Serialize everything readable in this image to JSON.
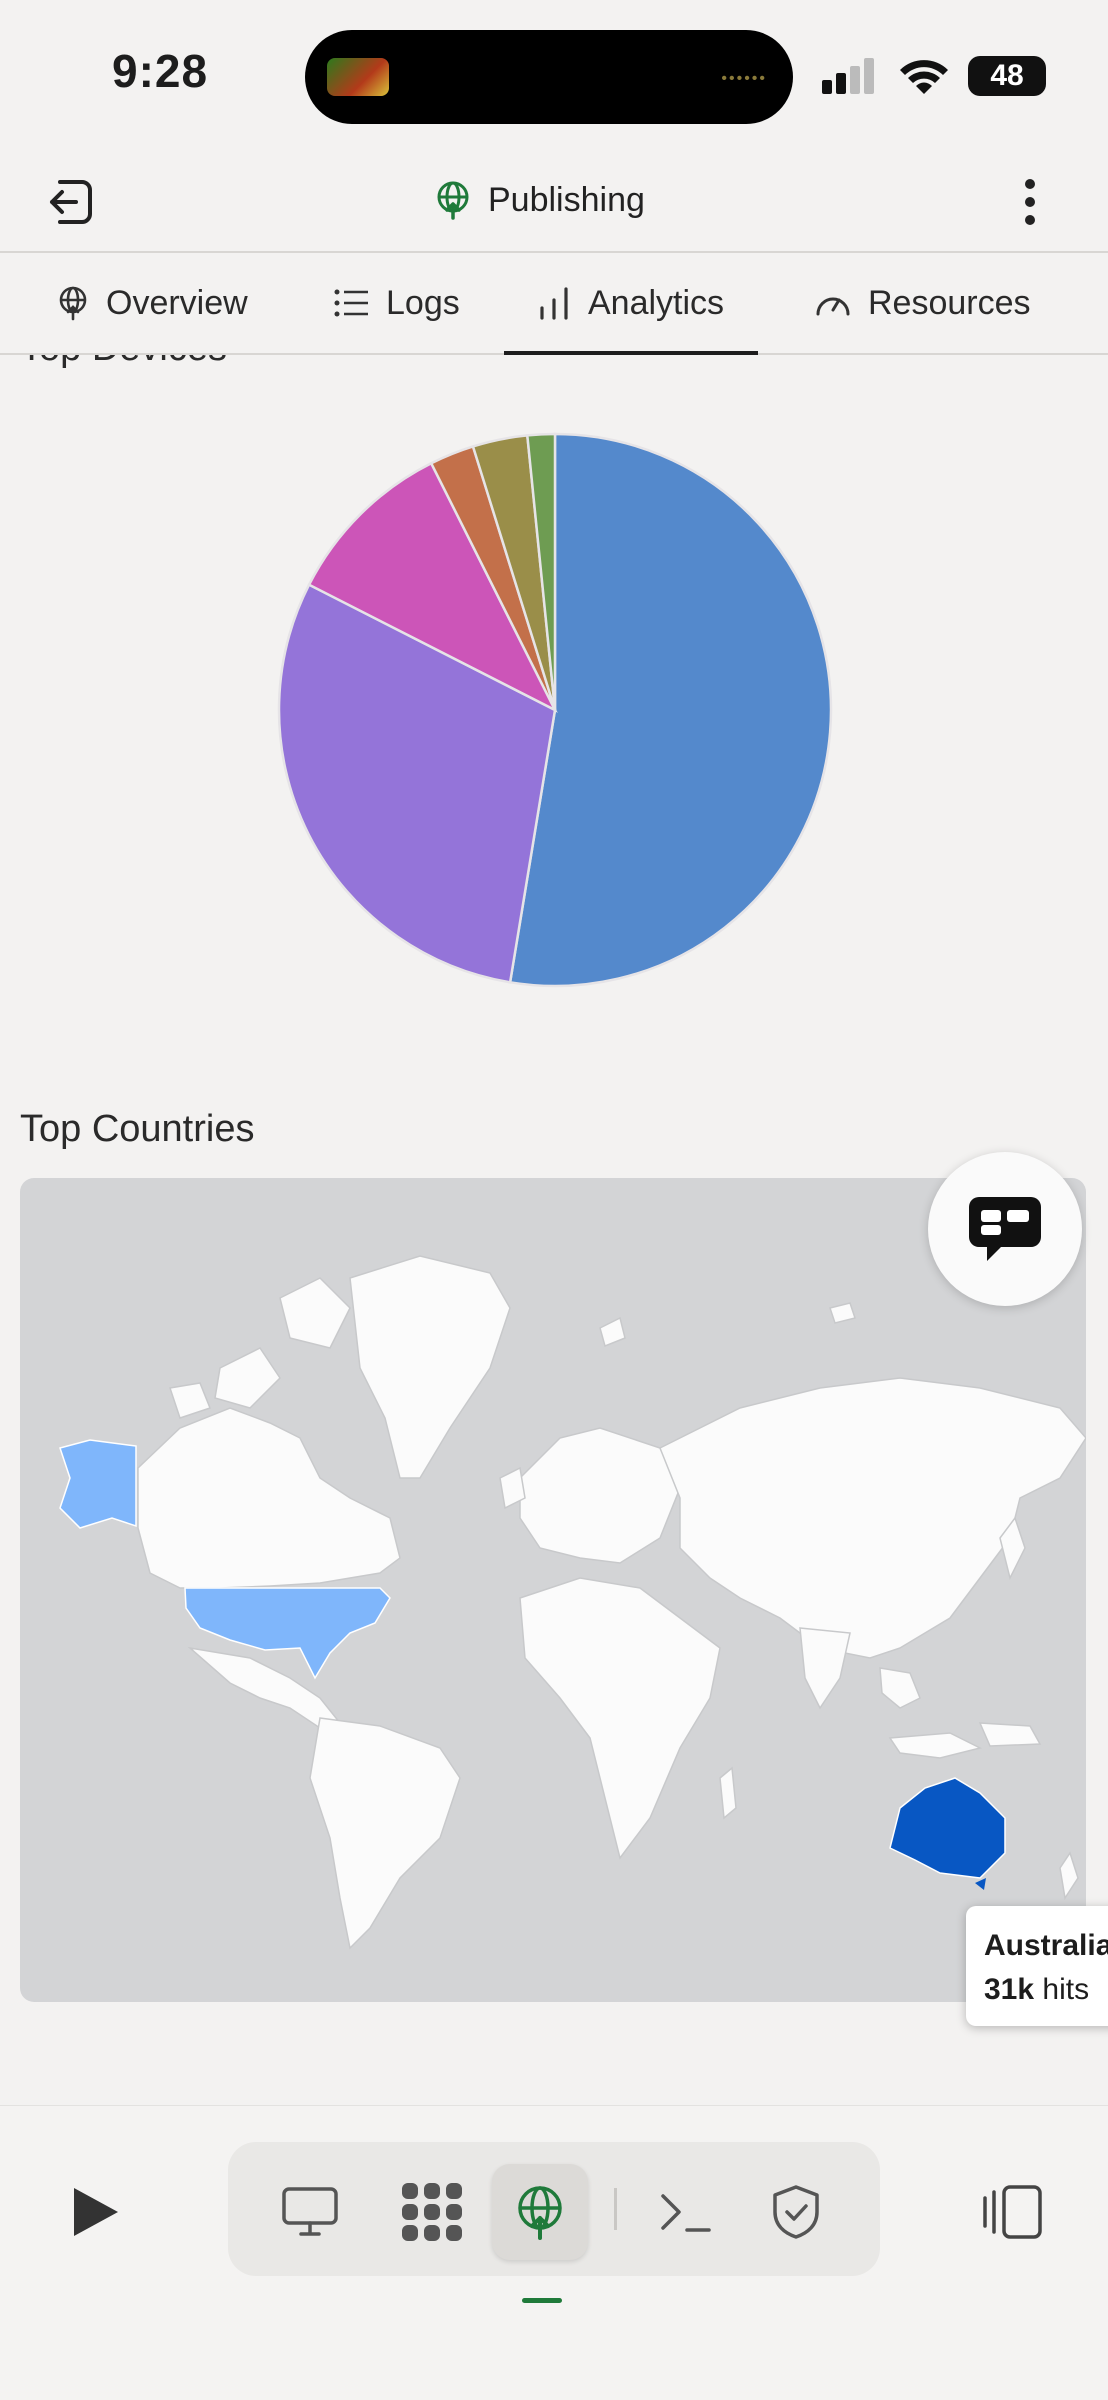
{
  "status_bar": {
    "time": "9:28",
    "battery": "48"
  },
  "header": {
    "title": "Publishing",
    "title_icon": "globe-upload-icon"
  },
  "tabs": [
    {
      "label": "Overview",
      "icon": "globe-icon",
      "active": false
    },
    {
      "label": "Logs",
      "icon": "list-icon",
      "active": false
    },
    {
      "label": "Analytics",
      "icon": "bar-chart-icon",
      "active": true
    },
    {
      "label": "Resources",
      "icon": "gauge-icon",
      "active": false
    }
  ],
  "devices": {
    "title": "Top Devices",
    "chart_data": {
      "type": "pie",
      "slices": [
        {
          "value": 52.6,
          "color": "#5489cc"
        },
        {
          "value": 29.9,
          "color": "#9474d9"
        },
        {
          "value": 10.1,
          "color": "#cc55b8"
        },
        {
          "value": 2.6,
          "color": "#c3704a"
        },
        {
          "value": 3.2,
          "color": "#9a8e49"
        },
        {
          "value": 1.6,
          "color": "#6e9c52"
        }
      ]
    }
  },
  "countries": {
    "title": "Top Countries",
    "highlight_colors": {
      "usa": "#7fb6fb",
      "australia": "#0857c3"
    },
    "tooltip": {
      "country": "Australia",
      "value": "31k",
      "unit": "hits"
    }
  },
  "toolbar": {
    "items": [
      "play-icon",
      "monitor-icon",
      "apps-icon",
      "globe-upload-icon",
      "terminal-icon",
      "shield-check-icon",
      "panel-icon"
    ],
    "active": "globe-upload-icon"
  }
}
